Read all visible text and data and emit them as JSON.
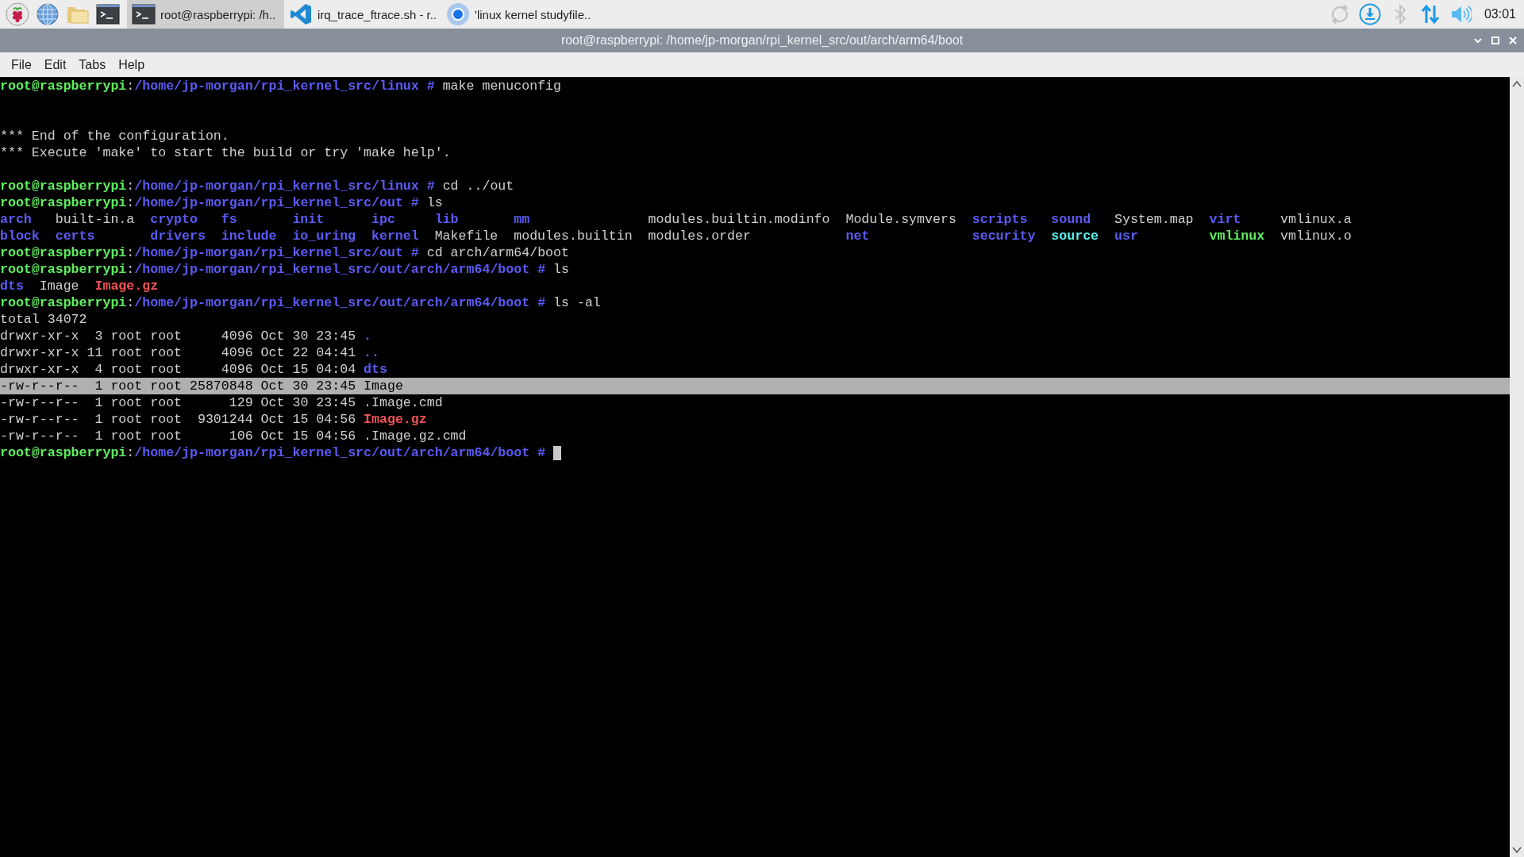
{
  "taskbar": {
    "launchers": [
      {
        "kind": "raspberry"
      },
      {
        "kind": "globe"
      },
      {
        "kind": "folder"
      },
      {
        "kind": "terminal"
      }
    ],
    "tasks": [
      {
        "kind": "terminal",
        "label": "root@raspberrypi: /h..",
        "selected": true
      },
      {
        "kind": "code",
        "label": "irq_trace_ftrace.sh - r..",
        "selected": false
      },
      {
        "kind": "browser",
        "label": "'linux kernel studyfile..",
        "selected": false
      }
    ],
    "tray": [
      {
        "kind": "sync",
        "active": false
      },
      {
        "kind": "download",
        "active": true
      },
      {
        "kind": "bluetooth",
        "active": false
      },
      {
        "kind": "network",
        "active": true
      },
      {
        "kind": "volume",
        "active": true
      }
    ],
    "clock": "03:01"
  },
  "window": {
    "title": "root@raspberrypi: /home/jp-morgan/rpi_kernel_src/out/arch/arm64/boot",
    "controls": [
      {
        "kind": "minimize"
      },
      {
        "kind": "maximize"
      },
      {
        "kind": "close"
      }
    ]
  },
  "menu": [
    "File",
    "Edit",
    "Tabs",
    "Help"
  ],
  "terminal": {
    "lines": [
      {
        "kind": "prompt",
        "user": "root@raspberrypi",
        "sep": ":",
        "path": "/home/jp-morgan/rpi_kernel_src/linux #",
        "command": "make menuconfig"
      },
      {
        "kind": "blank"
      },
      {
        "kind": "blank"
      },
      {
        "kind": "output",
        "highlighted": false,
        "segments": [
          {
            "text": "*** End of the configuration.",
            "kind": "plain"
          }
        ]
      },
      {
        "kind": "output",
        "highlighted": false,
        "segments": [
          {
            "text": "*** Execute 'make' to start the build or try 'make help'.",
            "kind": "plain"
          }
        ]
      },
      {
        "kind": "blank"
      },
      {
        "kind": "prompt",
        "user": "root@raspberrypi",
        "sep": ":",
        "path": "/home/jp-morgan/rpi_kernel_src/linux #",
        "command": "cd ../out"
      },
      {
        "kind": "prompt",
        "user": "root@raspberrypi",
        "sep": ":",
        "path": "/home/jp-morgan/rpi_kernel_src/out #",
        "command": "ls"
      },
      {
        "kind": "grid",
        "cells": [
          {
            "text": "arch",
            "kind": "dir"
          },
          {
            "text": "built-in.a",
            "kind": "plain"
          },
          {
            "text": "crypto",
            "kind": "dir"
          },
          {
            "text": "fs",
            "kind": "dir"
          },
          {
            "text": "init",
            "kind": "dir"
          },
          {
            "text": "ipc",
            "kind": "dir"
          },
          {
            "text": "lib",
            "kind": "dir"
          },
          {
            "text": "mm",
            "kind": "dir"
          },
          {
            "text": "modules.builtin.modinfo",
            "kind": "plain"
          },
          {
            "text": "Module.symvers",
            "kind": "plain"
          },
          {
            "text": "scripts",
            "kind": "dir"
          },
          {
            "text": "sound",
            "kind": "dir"
          },
          {
            "text": "System.map",
            "kind": "plain"
          },
          {
            "text": "virt",
            "kind": "dir"
          },
          {
            "text": "vmlinux.a",
            "kind": "plain"
          }
        ]
      },
      {
        "kind": "grid",
        "cells": [
          {
            "text": "block",
            "kind": "dir"
          },
          {
            "text": "certs",
            "kind": "dir"
          },
          {
            "text": "drivers",
            "kind": "dir"
          },
          {
            "text": "include",
            "kind": "dir"
          },
          {
            "text": "io_uring",
            "kind": "dir"
          },
          {
            "text": "kernel",
            "kind": "dir"
          },
          {
            "text": "Makefile",
            "kind": "plain"
          },
          {
            "text": "modules.builtin",
            "kind": "plain"
          },
          {
            "text": "modules.order",
            "kind": "plain"
          },
          {
            "text": "net",
            "kind": "dir"
          },
          {
            "text": "security",
            "kind": "dir"
          },
          {
            "text": "source",
            "kind": "link"
          },
          {
            "text": "usr",
            "kind": "dir"
          },
          {
            "text": "vmlinux",
            "kind": "exec"
          },
          {
            "text": "vmlinux.o",
            "kind": "plain"
          }
        ]
      },
      {
        "kind": "prompt",
        "user": "root@raspberrypi",
        "sep": ":",
        "path": "/home/jp-morgan/rpi_kernel_src/out #",
        "command": "cd arch/arm64/boot"
      },
      {
        "kind": "prompt",
        "user": "root@raspberrypi",
        "sep": ":",
        "path": "/home/jp-morgan/rpi_kernel_src/out/arch/arm64/boot #",
        "command": "ls"
      },
      {
        "kind": "output",
        "highlighted": false,
        "segments": [
          {
            "text": "dts",
            "kind": "dir"
          },
          {
            "text": "Image",
            "kind": "plain"
          },
          {
            "text": "Image.gz",
            "kind": "archive"
          }
        ]
      },
      {
        "kind": "prompt",
        "user": "root@raspberrypi",
        "sep": ":",
        "path": "/home/jp-morgan/rpi_kernel_src/out/arch/arm64/boot #",
        "command": "ls -al"
      },
      {
        "kind": "output",
        "highlighted": false,
        "segments": [
          {
            "text": "total 34072",
            "kind": "plain"
          }
        ]
      },
      {
        "kind": "output",
        "highlighted": false,
        "segments": [
          {
            "text": "drwxr-xr-x  3 root root     4096 Oct 30 23:45",
            "kind": "plain"
          },
          {
            "text": ".",
            "kind": "dir"
          }
        ]
      },
      {
        "kind": "output",
        "highlighted": false,
        "segments": [
          {
            "text": "drwxr-xr-x 11 root root     4096 Oct 22 04:41",
            "kind": "plain"
          },
          {
            "text": "..",
            "kind": "dir"
          }
        ]
      },
      {
        "kind": "output",
        "highlighted": false,
        "segments": [
          {
            "text": "drwxr-xr-x  4 root root     4096 Oct 15 04:04",
            "kind": "plain"
          },
          {
            "text": "dts",
            "kind": "dir"
          }
        ]
      },
      {
        "kind": "output",
        "highlighted": true,
        "segments": [
          {
            "text": "-rw-r--r--  1 root root 25870848 Oct 30 23:45",
            "kind": "plain"
          },
          {
            "text": "Image",
            "kind": "plain"
          }
        ]
      },
      {
        "kind": "output",
        "highlighted": false,
        "segments": [
          {
            "text": "-rw-r--r--  1 root root      129 Oct 30 23:45",
            "kind": "plain"
          },
          {
            "text": ".Image.cmd",
            "kind": "plain"
          }
        ]
      },
      {
        "kind": "output",
        "highlighted": false,
        "segments": [
          {
            "text": "-rw-r--r--  1 root root  9301244 Oct 15 04:56",
            "kind": "plain"
          },
          {
            "text": "Image.gz",
            "kind": "archive"
          }
        ]
      },
      {
        "kind": "output",
        "highlighted": false,
        "segments": [
          {
            "text": "-rw-r--r--  1 root root      106 Oct 15 04:56",
            "kind": "plain"
          },
          {
            "text": ".Image.gz.cmd",
            "kind": "plain"
          }
        ]
      },
      {
        "kind": "prompt",
        "user": "root@raspberrypi",
        "sep": ":",
        "path": "/home/jp-morgan/rpi_kernel_src/out/arch/arm64/boot #",
        "cursor": true
      }
    ]
  }
}
